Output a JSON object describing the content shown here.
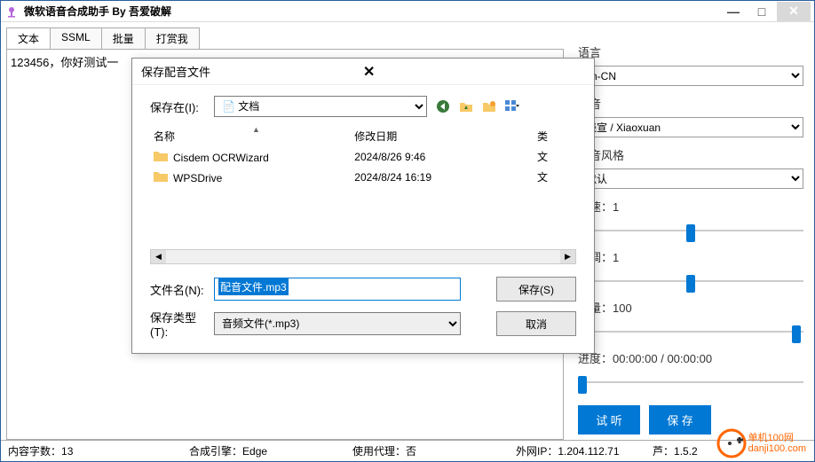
{
  "window": {
    "title": "微软语音合成助手 By 吾爱破解",
    "minimize": "—",
    "maximize": "□",
    "close": "✕"
  },
  "tabs": [
    "文本",
    "SSML",
    "批量",
    "打赏我"
  ],
  "textarea_value": "123456，你好测试一",
  "side": {
    "lang_label": "语言",
    "lang_value": "zh-CN",
    "voice_label": "声音",
    "voice_value": "晓宣 / Xiaoxuan",
    "style_label": "语音风格",
    "style_value": "默认",
    "speed_label": "语速：1",
    "pitch_label": "语调：1",
    "volume_label": "音量：100",
    "progress_label": "进度：00:00:00 / 00:00:00",
    "btn_listen": "试 听",
    "btn_save": "保 存"
  },
  "status": {
    "chars_label": "内容字数：",
    "chars_value": "13",
    "engine_label": "合成引擎：",
    "engine_value": "Edge",
    "proxy_label": "使用代理：",
    "proxy_value": "否",
    "ip_label": "外网IP：",
    "ip_value": "1.204.112.71",
    "ver_label": "芦：",
    "ver_value": "1.5.2"
  },
  "logo": {
    "line1": "单机100网",
    "line2": "danji100.com"
  },
  "dialog": {
    "title": "保存配音文件",
    "savein_label": "保存在(I):",
    "savein_value": "文档",
    "col_name": "名称",
    "col_date": "修改日期",
    "col_type": "类",
    "rows": [
      {
        "name": "Cisdem OCRWizard",
        "date": "2024/8/26 9:46",
        "type": "文"
      },
      {
        "name": "WPSDrive",
        "date": "2024/8/24 16:19",
        "type": "文"
      }
    ],
    "filename_label": "文件名(N):",
    "filename_value": "配音文件.mp3",
    "filetype_label": "保存类型(T):",
    "filetype_value": "音频文件(*.mp3)",
    "btn_save": "保存(S)",
    "btn_cancel": "取消"
  }
}
